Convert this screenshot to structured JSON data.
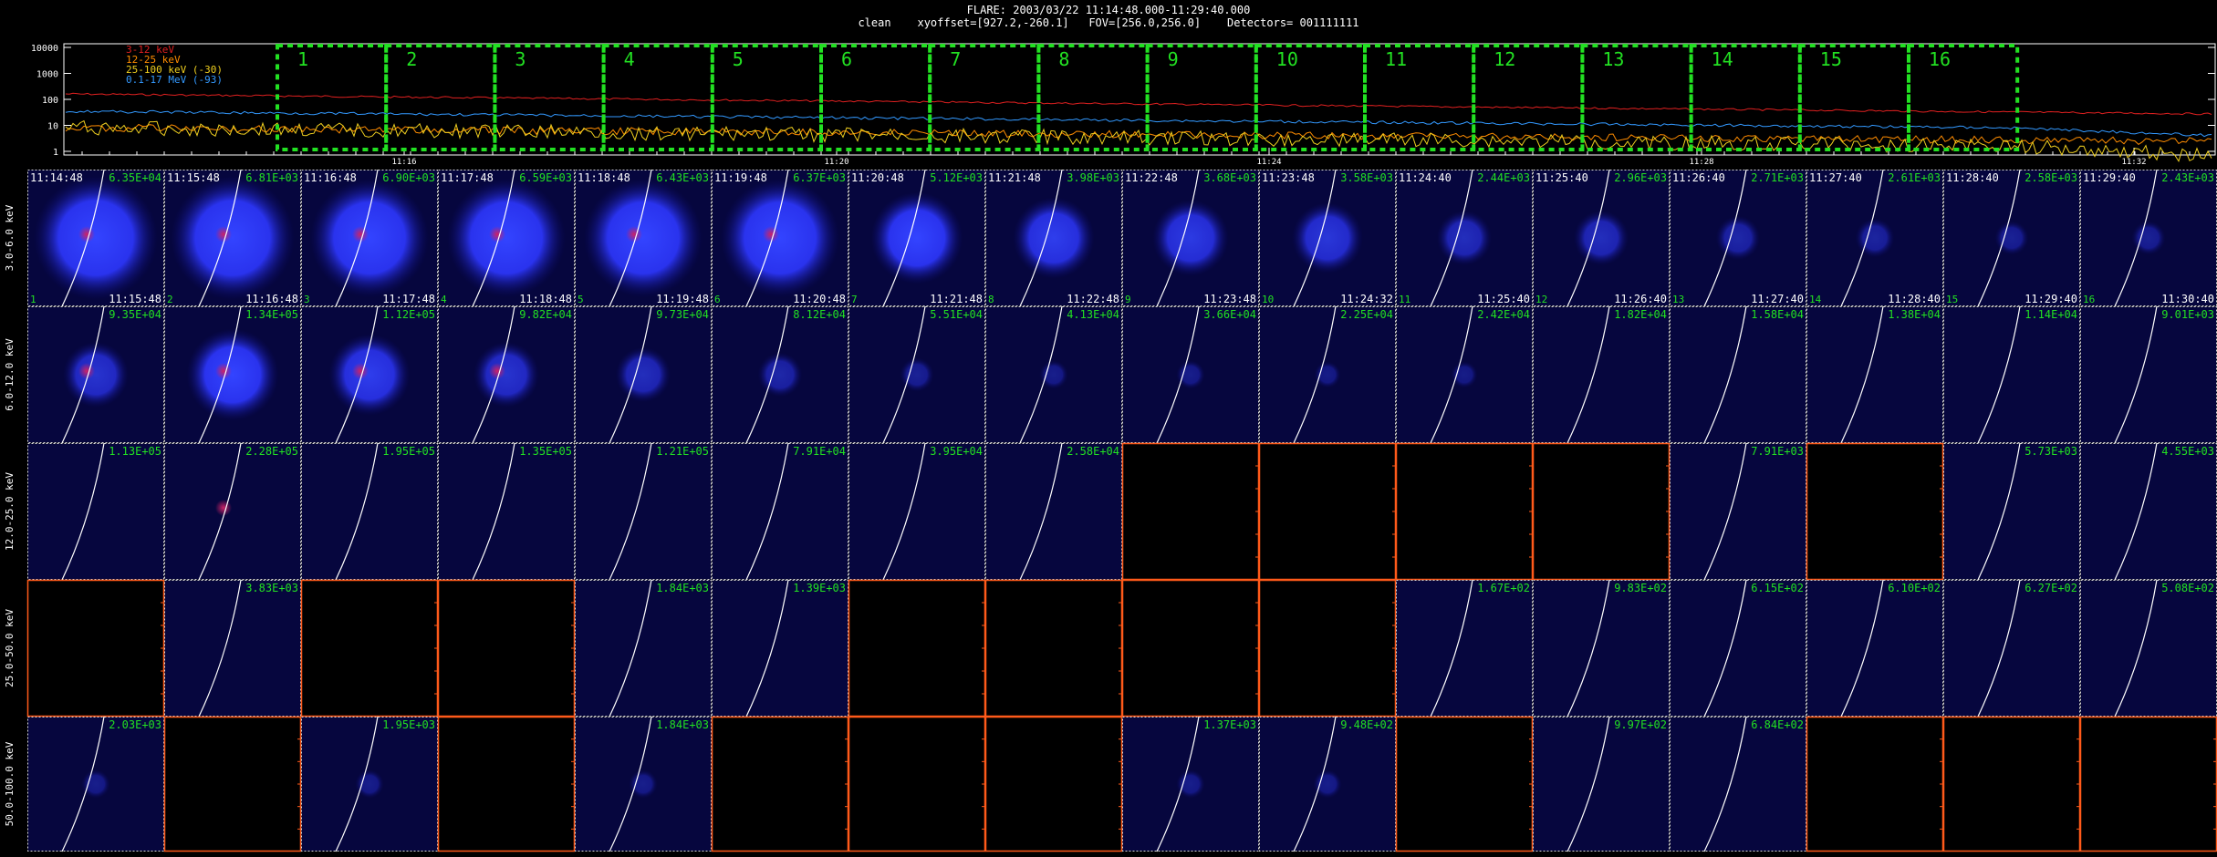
{
  "header": {
    "title_line1": "FLARE: 2003/03/22 11:14:48.000-11:29:40.000",
    "title_line2": "clean    xyoffset=[927.2,-260.1]   FOV=[256.0,256.0]    Detectors= 001111111"
  },
  "lightcurve": {
    "y_ticks": [
      "10000",
      "1000",
      "100",
      "10",
      "1"
    ],
    "x_ticks": [
      "11:16",
      "11:20",
      "11:24",
      "11:28",
      "11:32"
    ],
    "legend": [
      {
        "label": "3-12 keV",
        "color": "#e02020"
      },
      {
        "label": "12-25 keV",
        "color": "#ff8c00"
      },
      {
        "label": "25-100 keV (-30)",
        "color": "#f0d020"
      },
      {
        "label": "0.1-17 MeV (-93)",
        "color": "#3399ff"
      }
    ],
    "intervals": [
      "1",
      "2",
      "3",
      "4",
      "5",
      "6",
      "7",
      "8",
      "9",
      "10",
      "11",
      "12",
      "13",
      "14",
      "15",
      "16"
    ],
    "box_color": "#22e022"
  },
  "rows": [
    {
      "label": "3.0-6.0 keV",
      "cells": [
        {
          "tl": "11:14:48",
          "tr": "6.35E+04",
          "bl": "1",
          "br": "11:15:48",
          "blob": 1.0,
          "core": true
        },
        {
          "tl": "11:15:48",
          "tr": "6.81E+03",
          "bl": "2",
          "br": "11:16:48",
          "blob": 1.0,
          "core": true
        },
        {
          "tl": "11:16:48",
          "tr": "6.90E+03",
          "bl": "3",
          "br": "11:17:48",
          "blob": 0.95,
          "core": true
        },
        {
          "tl": "11:17:48",
          "tr": "6.59E+03",
          "bl": "4",
          "br": "11:18:48",
          "blob": 0.95,
          "core": true
        },
        {
          "tl": "11:18:48",
          "tr": "6.43E+03",
          "bl": "5",
          "br": "11:19:48",
          "blob": 0.95,
          "core": true
        },
        {
          "tl": "11:19:48",
          "tr": "6.37E+03",
          "bl": "6",
          "br": "11:20:48",
          "blob": 0.95,
          "core": true
        },
        {
          "tl": "11:20:48",
          "tr": "5.12E+03",
          "bl": "7",
          "br": "11:21:48",
          "blob": 0.7,
          "core": false
        },
        {
          "tl": "11:21:48",
          "tr": "3.98E+03",
          "bl": "8",
          "br": "11:22:48",
          "blob": 0.6,
          "core": false
        },
        {
          "tl": "11:22:48",
          "tr": "3.68E+03",
          "bl": "9",
          "br": "11:23:48",
          "blob": 0.55,
          "core": false
        },
        {
          "tl": "11:23:48",
          "tr": "3.58E+03",
          "bl": "10",
          "br": "11:24:32",
          "blob": 0.5,
          "core": false
        },
        {
          "tl": "11:24:40",
          "tr": "2.44E+03",
          "bl": "11",
          "br": "11:25:40",
          "blob": 0.35,
          "core": false
        },
        {
          "tl": "11:25:40",
          "tr": "2.96E+03",
          "bl": "12",
          "br": "11:26:40",
          "blob": 0.35,
          "core": false
        },
        {
          "tl": "11:26:40",
          "tr": "2.71E+03",
          "bl": "13",
          "br": "11:27:40",
          "blob": 0.25,
          "core": false
        },
        {
          "tl": "11:27:40",
          "tr": "2.61E+03",
          "bl": "14",
          "br": "11:28:40",
          "blob": 0.2,
          "core": false
        },
        {
          "tl": "11:28:40",
          "tr": "2.58E+03",
          "bl": "15",
          "br": "11:29:40",
          "blob": 0.15,
          "core": false
        },
        {
          "tl": "11:29:40",
          "tr": "2.43E+03",
          "bl": "16",
          "br": "11:30:40",
          "blob": 0.15,
          "core": false
        }
      ]
    },
    {
      "label": "6.0-12.0 keV",
      "cells": [
        {
          "tr": "9.35E+04",
          "blob": 0.45,
          "core": true
        },
        {
          "tr": "1.34E+05",
          "blob": 0.7,
          "core": true
        },
        {
          "tr": "1.12E+05",
          "blob": 0.6,
          "core": true
        },
        {
          "tr": "9.82E+04",
          "blob": 0.45,
          "core": true
        },
        {
          "tr": "9.73E+04",
          "blob": 0.35,
          "core": false
        },
        {
          "tr": "8.12E+04",
          "blob": 0.25,
          "core": false
        },
        {
          "tr": "5.51E+04",
          "blob": 0.15,
          "core": false
        },
        {
          "tr": "4.13E+04",
          "blob": 0.1,
          "core": false
        },
        {
          "tr": "3.66E+04",
          "blob": 0.1,
          "core": false
        },
        {
          "tr": "2.25E+04",
          "blob": 0.08,
          "core": false
        },
        {
          "tr": "2.42E+04",
          "blob": 0.08,
          "core": false
        },
        {
          "tr": "1.82E+04",
          "blob": 0.05,
          "core": false
        },
        {
          "tr": "1.58E+04",
          "blob": 0.05,
          "core": false
        },
        {
          "tr": "1.38E+04",
          "blob": 0.05,
          "core": false
        },
        {
          "tr": "1.14E+04",
          "blob": 0.05,
          "core": false
        },
        {
          "tr": "9.01E+03",
          "blob": 0.05,
          "core": false
        }
      ]
    },
    {
      "label": "12.0-25.0 keV",
      "cells": [
        {
          "tr": "1.13E+05",
          "blob": 0.05,
          "core": false
        },
        {
          "tr": "2.28E+05",
          "blob": 0.05,
          "core": true
        },
        {
          "tr": "1.95E+05",
          "blob": 0.05,
          "core": false
        },
        {
          "tr": "1.35E+05",
          "blob": 0.05,
          "core": false
        },
        {
          "tr": "1.21E+05",
          "blob": 0.05,
          "core": false
        },
        {
          "tr": "7.91E+04",
          "blob": 0.05,
          "core": false
        },
        {
          "tr": "3.95E+04",
          "blob": 0.05,
          "core": false
        },
        {
          "tr": "2.58E+04",
          "blob": 0.05,
          "core": false
        },
        {
          "empty": true
        },
        {
          "empty": true
        },
        {
          "empty": true
        },
        {
          "empty": true
        },
        {
          "tr": "7.91E+03",
          "blob": 0.05,
          "core": false
        },
        {
          "empty": true
        },
        {
          "tr": "5.73E+03",
          "blob": 0.05,
          "core": false
        },
        {
          "tr": "4.55E+03",
          "blob": 0.05,
          "core": false
        }
      ]
    },
    {
      "label": "25.0-50.0 keV",
      "cells": [
        {
          "empty": true
        },
        {
          "tr": "3.83E+03",
          "blob": 0.05,
          "core": false
        },
        {
          "empty": true
        },
        {
          "empty": true
        },
        {
          "tr": "1.84E+03",
          "blob": 0.05,
          "core": false
        },
        {
          "tr": "1.39E+03",
          "blob": 0.05,
          "core": false
        },
        {
          "empty": true
        },
        {
          "empty": true
        },
        {
          "empty": true
        },
        {
          "empty": true
        },
        {
          "tr": "1.67E+02",
          "blob": 0.05,
          "core": false
        },
        {
          "tr": "9.83E+02",
          "blob": 0.05,
          "core": false
        },
        {
          "tr": "6.15E+02",
          "blob": 0.05,
          "core": false
        },
        {
          "tr": "6.10E+02",
          "blob": 0.05,
          "core": false
        },
        {
          "tr": "6.27E+02",
          "blob": 0.05,
          "core": false
        },
        {
          "tr": "5.08E+02",
          "blob": 0.05,
          "core": false
        }
      ]
    },
    {
      "label": "50.0-100.0 keV",
      "cells": [
        {
          "tr": "2.03E+03",
          "blob": 0.1,
          "core": false
        },
        {
          "empty": true
        },
        {
          "tr": "1.95E+03",
          "blob": 0.1,
          "core": false
        },
        {
          "empty": true
        },
        {
          "tr": "1.84E+03",
          "blob": 0.1,
          "core": false
        },
        {
          "empty": true
        },
        {
          "empty": true
        },
        {
          "empty": true
        },
        {
          "tr": "1.37E+03",
          "blob": 0.1,
          "core": false
        },
        {
          "tr": "9.48E+02",
          "blob": 0.1,
          "core": false
        },
        {
          "empty": true
        },
        {
          "tr": "9.97E+02",
          "blob": 0.05,
          "core": false
        },
        {
          "tr": "6.84E+02",
          "blob": 0.05,
          "core": false
        },
        {
          "empty": true
        },
        {
          "empty": true
        },
        {
          "empty": true
        }
      ]
    }
  ]
}
